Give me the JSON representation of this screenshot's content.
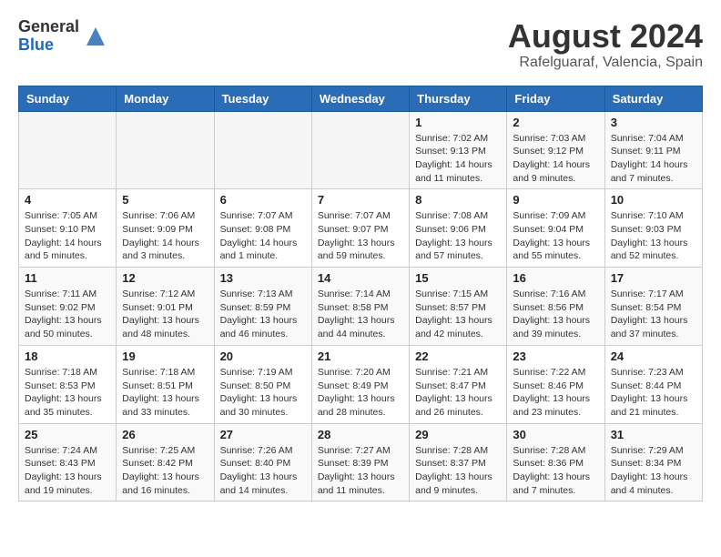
{
  "logo": {
    "general": "General",
    "blue": "Blue"
  },
  "title": "August 2024",
  "location": "Rafelguaraf, Valencia, Spain",
  "days_of_week": [
    "Sunday",
    "Monday",
    "Tuesday",
    "Wednesday",
    "Thursday",
    "Friday",
    "Saturday"
  ],
  "weeks": [
    [
      {
        "day": "",
        "info": ""
      },
      {
        "day": "",
        "info": ""
      },
      {
        "day": "",
        "info": ""
      },
      {
        "day": "",
        "info": ""
      },
      {
        "day": "1",
        "info": "Sunrise: 7:02 AM\nSunset: 9:13 PM\nDaylight: 14 hours\nand 11 minutes."
      },
      {
        "day": "2",
        "info": "Sunrise: 7:03 AM\nSunset: 9:12 PM\nDaylight: 14 hours\nand 9 minutes."
      },
      {
        "day": "3",
        "info": "Sunrise: 7:04 AM\nSunset: 9:11 PM\nDaylight: 14 hours\nand 7 minutes."
      }
    ],
    [
      {
        "day": "4",
        "info": "Sunrise: 7:05 AM\nSunset: 9:10 PM\nDaylight: 14 hours\nand 5 minutes."
      },
      {
        "day": "5",
        "info": "Sunrise: 7:06 AM\nSunset: 9:09 PM\nDaylight: 14 hours\nand 3 minutes."
      },
      {
        "day": "6",
        "info": "Sunrise: 7:07 AM\nSunset: 9:08 PM\nDaylight: 14 hours\nand 1 minute."
      },
      {
        "day": "7",
        "info": "Sunrise: 7:07 AM\nSunset: 9:07 PM\nDaylight: 13 hours\nand 59 minutes."
      },
      {
        "day": "8",
        "info": "Sunrise: 7:08 AM\nSunset: 9:06 PM\nDaylight: 13 hours\nand 57 minutes."
      },
      {
        "day": "9",
        "info": "Sunrise: 7:09 AM\nSunset: 9:04 PM\nDaylight: 13 hours\nand 55 minutes."
      },
      {
        "day": "10",
        "info": "Sunrise: 7:10 AM\nSunset: 9:03 PM\nDaylight: 13 hours\nand 52 minutes."
      }
    ],
    [
      {
        "day": "11",
        "info": "Sunrise: 7:11 AM\nSunset: 9:02 PM\nDaylight: 13 hours\nand 50 minutes."
      },
      {
        "day": "12",
        "info": "Sunrise: 7:12 AM\nSunset: 9:01 PM\nDaylight: 13 hours\nand 48 minutes."
      },
      {
        "day": "13",
        "info": "Sunrise: 7:13 AM\nSunset: 8:59 PM\nDaylight: 13 hours\nand 46 minutes."
      },
      {
        "day": "14",
        "info": "Sunrise: 7:14 AM\nSunset: 8:58 PM\nDaylight: 13 hours\nand 44 minutes."
      },
      {
        "day": "15",
        "info": "Sunrise: 7:15 AM\nSunset: 8:57 PM\nDaylight: 13 hours\nand 42 minutes."
      },
      {
        "day": "16",
        "info": "Sunrise: 7:16 AM\nSunset: 8:56 PM\nDaylight: 13 hours\nand 39 minutes."
      },
      {
        "day": "17",
        "info": "Sunrise: 7:17 AM\nSunset: 8:54 PM\nDaylight: 13 hours\nand 37 minutes."
      }
    ],
    [
      {
        "day": "18",
        "info": "Sunrise: 7:18 AM\nSunset: 8:53 PM\nDaylight: 13 hours\nand 35 minutes."
      },
      {
        "day": "19",
        "info": "Sunrise: 7:18 AM\nSunset: 8:51 PM\nDaylight: 13 hours\nand 33 minutes."
      },
      {
        "day": "20",
        "info": "Sunrise: 7:19 AM\nSunset: 8:50 PM\nDaylight: 13 hours\nand 30 minutes."
      },
      {
        "day": "21",
        "info": "Sunrise: 7:20 AM\nSunset: 8:49 PM\nDaylight: 13 hours\nand 28 minutes."
      },
      {
        "day": "22",
        "info": "Sunrise: 7:21 AM\nSunset: 8:47 PM\nDaylight: 13 hours\nand 26 minutes."
      },
      {
        "day": "23",
        "info": "Sunrise: 7:22 AM\nSunset: 8:46 PM\nDaylight: 13 hours\nand 23 minutes."
      },
      {
        "day": "24",
        "info": "Sunrise: 7:23 AM\nSunset: 8:44 PM\nDaylight: 13 hours\nand 21 minutes."
      }
    ],
    [
      {
        "day": "25",
        "info": "Sunrise: 7:24 AM\nSunset: 8:43 PM\nDaylight: 13 hours\nand 19 minutes."
      },
      {
        "day": "26",
        "info": "Sunrise: 7:25 AM\nSunset: 8:42 PM\nDaylight: 13 hours\nand 16 minutes."
      },
      {
        "day": "27",
        "info": "Sunrise: 7:26 AM\nSunset: 8:40 PM\nDaylight: 13 hours\nand 14 minutes."
      },
      {
        "day": "28",
        "info": "Sunrise: 7:27 AM\nSunset: 8:39 PM\nDaylight: 13 hours\nand 11 minutes."
      },
      {
        "day": "29",
        "info": "Sunrise: 7:28 AM\nSunset: 8:37 PM\nDaylight: 13 hours\nand 9 minutes."
      },
      {
        "day": "30",
        "info": "Sunrise: 7:28 AM\nSunset: 8:36 PM\nDaylight: 13 hours\nand 7 minutes."
      },
      {
        "day": "31",
        "info": "Sunrise: 7:29 AM\nSunset: 8:34 PM\nDaylight: 13 hours\nand 4 minutes."
      }
    ]
  ]
}
